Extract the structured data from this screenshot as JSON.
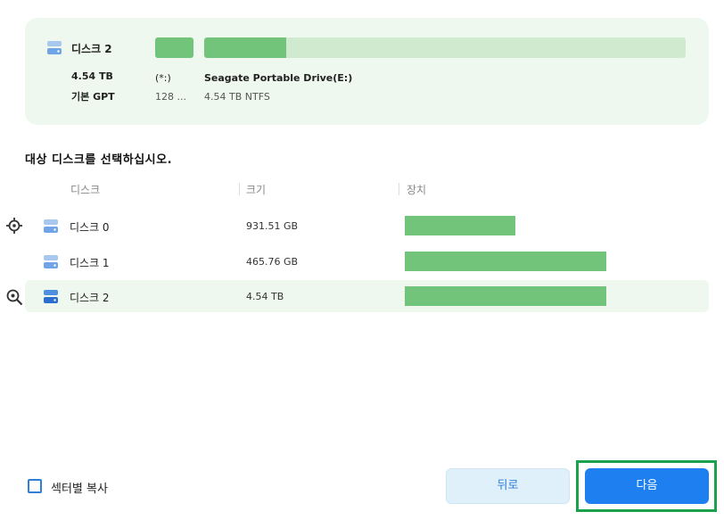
{
  "source_disk": {
    "name": "디스크 2",
    "size": "4.54 TB",
    "partition_style": "기본 GPT",
    "partitions": [
      {
        "label": "(*:)",
        "detail": "128 ..."
      },
      {
        "label": "Seagate Portable Drive(E:)",
        "detail": "4.54 TB NTFS",
        "used_fraction": 0.17
      }
    ]
  },
  "target": {
    "title": "대상 디스크를 선택하십시오.",
    "columns": {
      "disk": "디스크",
      "size": "크기",
      "device": "장치"
    },
    "disks": [
      {
        "name": "디스크 0",
        "size": "931.51 GB",
        "bar_fraction": 0.55,
        "side_icon": "target-icon",
        "selected": false
      },
      {
        "name": "디스크 1",
        "size": "465.76 GB",
        "bar_fraction": 1.0,
        "side_icon": "",
        "selected": false
      },
      {
        "name": "디스크 2",
        "size": "4.54 TB",
        "bar_fraction": 1.0,
        "side_icon": "target-search-icon",
        "selected": true
      }
    ]
  },
  "footer": {
    "sector_copy_label": "섹터별 복사",
    "sector_copy_checked": false,
    "back_label": "뒤로",
    "next_label": "다음"
  },
  "colors": {
    "accent": "#1e80f0",
    "bar_green": "#72c47a",
    "card_bg": "#eef8ee",
    "highlight_border": "#19a24a"
  }
}
